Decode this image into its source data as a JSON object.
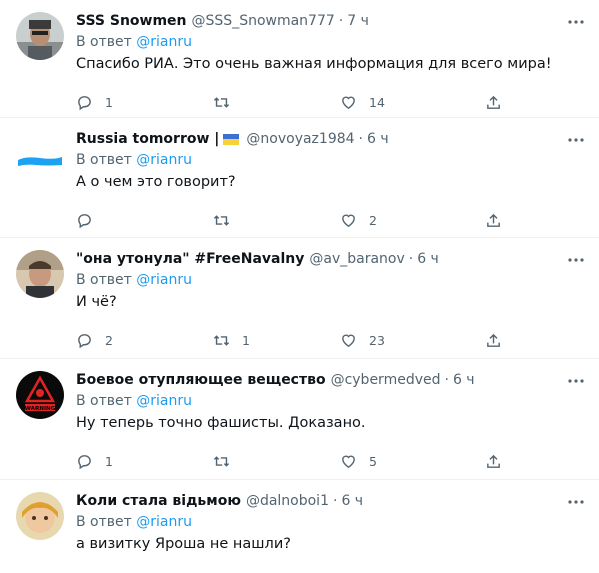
{
  "icon_color": "#536471",
  "link_color": "#1d9bf0",
  "tweets": [
    {
      "name": "SSS Snowmen",
      "handle": "@SSS_Snowman777",
      "separator": "·",
      "time": "7 ч",
      "reply_prefix": "В ответ",
      "reply_to": "@rianru",
      "text": "Спасибо РИА. Это очень важная информация для всего мира!",
      "reply_count": "1",
      "retweet_count": "",
      "like_count": "14"
    },
    {
      "name": "Russia tomorrow |",
      "flag": "ukraine-flag",
      "handle": "@novoyaz1984",
      "separator": "·",
      "time": "6 ч",
      "reply_prefix": "В ответ",
      "reply_to": "@rianru",
      "text": "А о чем это говорит?",
      "reply_count": "",
      "retweet_count": "",
      "like_count": "2"
    },
    {
      "name": "\"она утонула\" #FreeNavalny",
      "handle": "@av_baranov",
      "separator": "·",
      "time": "6 ч",
      "reply_prefix": "В ответ",
      "reply_to": "@rianru",
      "text": "И чё?",
      "reply_count": "2",
      "retweet_count": "1",
      "like_count": "23"
    },
    {
      "name": "Боевое отупляющее вещество",
      "handle": "@cybermedved",
      "separator": "·",
      "time": "6 ч",
      "reply_prefix": "В ответ",
      "reply_to": "@rianru",
      "text": "Ну теперь точно фашисты. Доказано.",
      "reply_count": "1",
      "retweet_count": "",
      "like_count": "5",
      "avatar_text": "WARNING"
    },
    {
      "name": "Коли стала відьмою",
      "handle": "@dalnoboi1",
      "separator": "·",
      "time": "6 ч",
      "reply_prefix": "В ответ",
      "reply_to": "@rianru",
      "text": "а визитку Яроша не нашли?",
      "reply_count": "",
      "retweet_count": "",
      "like_count": ""
    }
  ]
}
